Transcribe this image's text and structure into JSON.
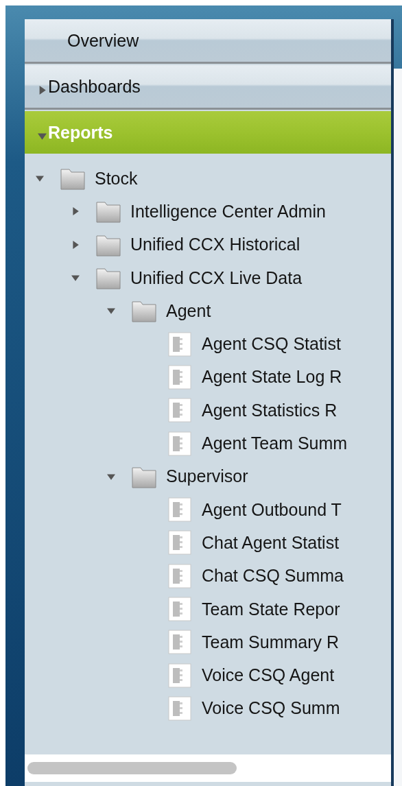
{
  "nav": [
    {
      "label": "Overview",
      "kind": "plain",
      "selected": false
    },
    {
      "label": "Dashboards",
      "kind": "expandable",
      "expanded": false,
      "selected": false
    },
    {
      "label": "Reports",
      "kind": "expandable",
      "expanded": true,
      "selected": true
    }
  ],
  "tree": [
    {
      "label": "Stock",
      "kind": "folder",
      "expanded": true,
      "children": [
        {
          "label": "Intelligence Center Admin",
          "kind": "folder",
          "expanded": false
        },
        {
          "label": "Unified CCX Historical",
          "kind": "folder",
          "expanded": false
        },
        {
          "label": "Unified CCX Live Data",
          "kind": "folder",
          "expanded": true,
          "children": [
            {
              "label": "Agent",
              "kind": "folder",
              "expanded": true,
              "children": [
                {
                  "label": "Agent CSQ Statist",
                  "kind": "report"
                },
                {
                  "label": "Agent State Log R",
                  "kind": "report"
                },
                {
                  "label": "Agent Statistics R",
                  "kind": "report"
                },
                {
                  "label": "Agent Team Summ",
                  "kind": "report"
                }
              ]
            },
            {
              "label": "Supervisor",
              "kind": "folder",
              "expanded": true,
              "children": [
                {
                  "label": "Agent Outbound T",
                  "kind": "report"
                },
                {
                  "label": "Chat Agent Statist",
                  "kind": "report"
                },
                {
                  "label": "Chat CSQ Summa",
                  "kind": "report"
                },
                {
                  "label": "Team State Repor",
                  "kind": "report"
                },
                {
                  "label": "Team Summary R",
                  "kind": "report"
                },
                {
                  "label": "Voice CSQ Agent",
                  "kind": "report"
                },
                {
                  "label": "Voice CSQ Summ",
                  "kind": "report"
                }
              ]
            }
          ]
        }
      ]
    }
  ]
}
